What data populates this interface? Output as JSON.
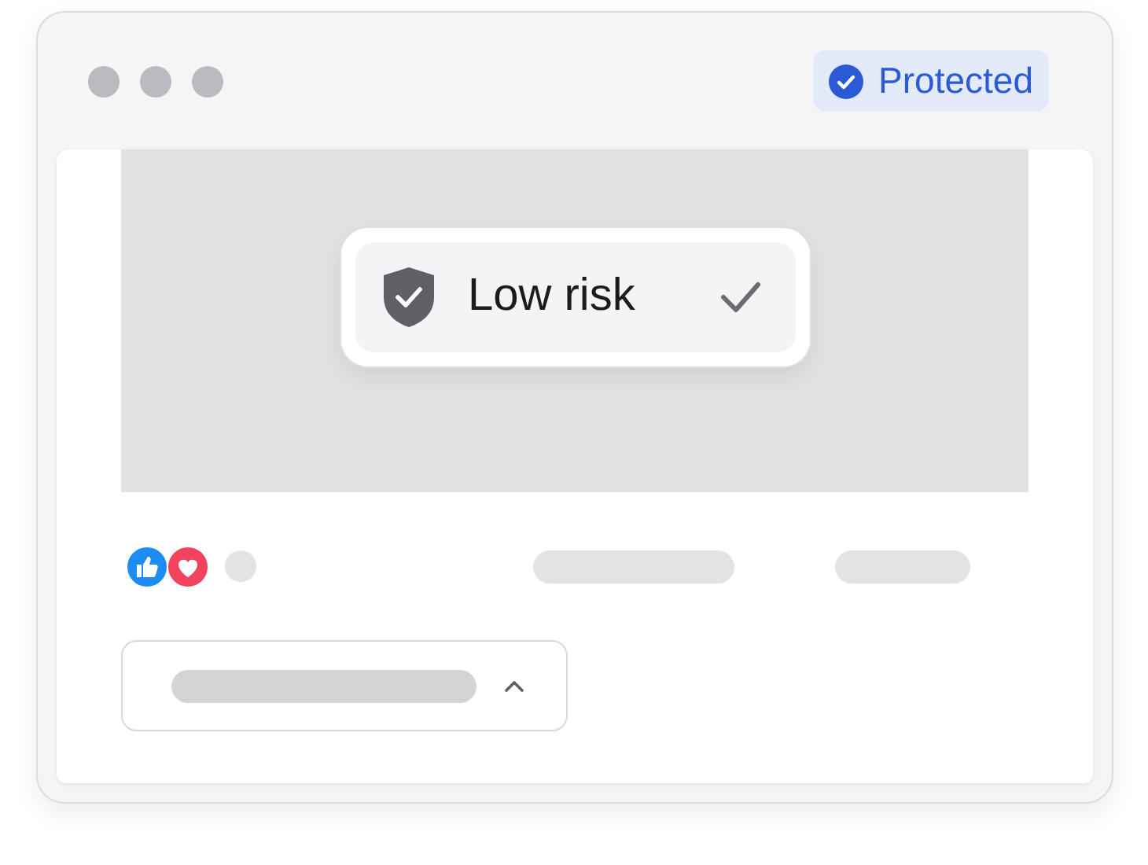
{
  "badge": {
    "label": "Protected"
  },
  "risk_chip": {
    "label": "Low risk"
  },
  "dropdown": {
    "expanded": true
  }
}
